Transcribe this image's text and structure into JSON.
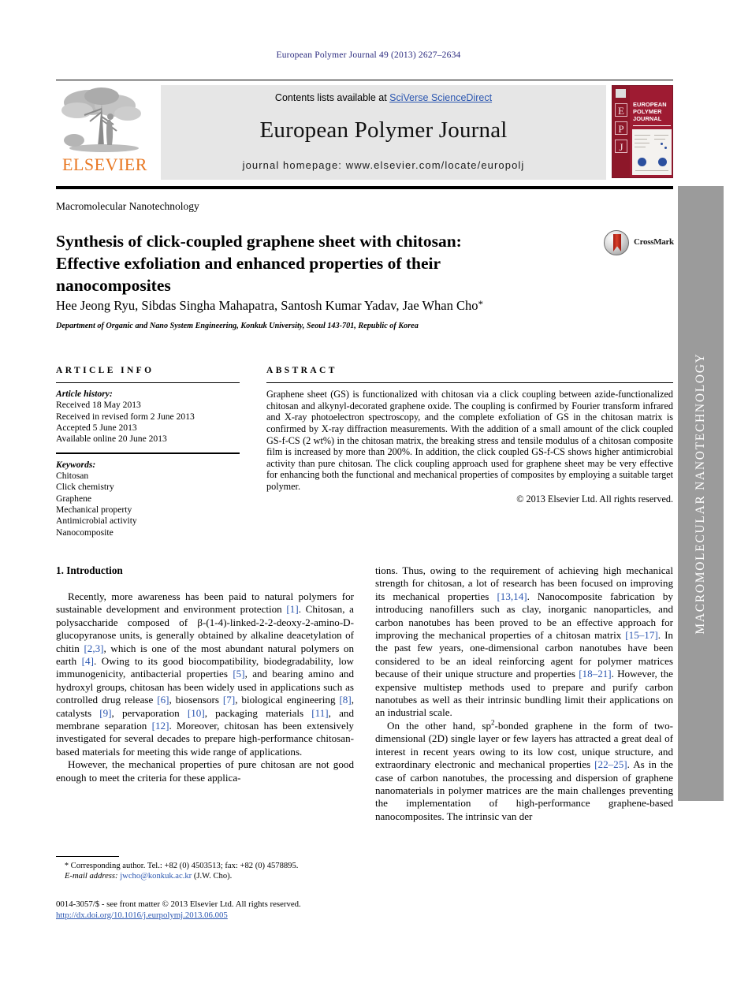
{
  "running_head": "European Polymer Journal 49 (2013) 2627–2634",
  "masthead": {
    "contents_prefix": "Contents lists available at ",
    "contents_link": "SciVerse ScienceDirect",
    "journal_name": "European Polymer Journal",
    "homepage": "journal homepage: www.elsevier.com/locate/europolj",
    "publisher": "ELSEVIER",
    "cover": {
      "title_line1": "EUROPEAN",
      "title_line2": "POLYMER",
      "title_line3": "JOURNAL",
      "letters": [
        "E",
        "P",
        "J"
      ]
    }
  },
  "section_tag": "Macromolecular Nanotechnology",
  "title": "Synthesis of click-coupled graphene sheet with chitosan: Effective exfoliation and enhanced properties of their nanocomposites",
  "crossmark_label": "CrossMark",
  "authors": "Hee Jeong Ryu, Sibdas Singha Mahapatra, Santosh Kumar Yadav, Jae Whan Cho",
  "author_star": "*",
  "affiliation": "Department of Organic and Nano System Engineering, Konkuk University, Seoul 143-701, Republic of Korea",
  "article_info": {
    "heading": "ARTICLE INFO",
    "history_label": "Article history:",
    "history": [
      "Received 18 May 2013",
      "Received in revised form 2 June 2013",
      "Accepted 5 June 2013",
      "Available online 20 June 2013"
    ],
    "keywords_label": "Keywords:",
    "keywords": [
      "Chitosan",
      "Click chemistry",
      "Graphene",
      "Mechanical property",
      "Antimicrobial activity",
      "Nanocomposite"
    ]
  },
  "abstract": {
    "heading": "ABSTRACT",
    "text": "Graphene sheet (GS) is functionalized with chitosan via a click coupling between azide-functionalized chitosan and alkynyl-decorated graphene oxide. The coupling is confirmed by Fourier transform infrared and X-ray photoelectron spectroscopy, and the complete exfoliation of GS in the chitosan matrix is confirmed by X-ray diffraction measurements. With the addition of a small amount of the click coupled GS-f-CS (2 wt%) in the chitosan matrix, the breaking stress and tensile modulus of a chitosan composite film is increased by more than 200%. In addition, the click coupled GS-f-CS shows higher antimicrobial activity than pure chitosan. The click coupling approach used for graphene sheet may be very effective for enhancing both the functional and mechanical properties of composites by employing a suitable target polymer.",
    "rights": "© 2013 Elsevier Ltd. All rights reserved."
  },
  "body": {
    "intro_heading": "1. Introduction",
    "left_paras": [
      "Recently, more awareness has been paid to natural polymers for sustainable development and environment protection [1]. Chitosan, a polysaccharide composed of β-(1-4)-linked-2-2-deoxy-2-amino-D-glucopyranose units, is generally obtained by alkaline deacetylation of chitin [2,3], which is one of the most abundant natural polymers on earth [4]. Owing to its good biocompatibility, biodegradability, low immunogenicity, antibacterial properties [5], and bearing amino and hydroxyl groups, chitosan has been widely used in applications such as controlled drug release [6], biosensors [7], biological engineering [8], catalysts [9], pervaporation [10], packaging materials [11], and membrane separation [12]. Moreover, chitosan has been extensively investigated for several decades to prepare high-performance chitosan-based materials for meeting this wide range of applications.",
      "However, the mechanical properties of pure chitosan are not good enough to meet the criteria for these applica-"
    ],
    "right_paras": [
      "tions. Thus, owing to the requirement of achieving high mechanical strength for chitosan, a lot of research has been focused on improving its mechanical properties [13,14]. Nanocomposite fabrication by introducing nanofillers such as clay, inorganic nanoparticles, and carbon nanotubes has been proved to be an effective approach for improving the mechanical properties of a chitosan matrix [15–17]. In the past few years, one-dimensional carbon nanotubes have been considered to be an ideal reinforcing agent for polymer matrices because of their unique structure and properties [18–21]. However, the expensive multistep methods used to prepare and purify carbon nanotubes as well as their intrinsic bundling limit their applications on an industrial scale.",
      "On the other hand, sp2-bonded graphene in the form of two-dimensional (2D) single layer or few layers has attracted a great deal of interest in recent years owing to its low cost, unique structure, and extraordinary electronic and mechanical properties [22–25]. As in the case of carbon nanotubes, the processing and dispersion of graphene nanomaterials in polymer matrices are the main challenges preventing the implementation of high-performance graphene-based nanocomposites. The intrinsic van der"
    ]
  },
  "footnote": {
    "star": "*",
    "corresponding": " Corresponding author. Tel.: +82 (0) 4503513; fax: +82 (0) 4578895.",
    "email_label": "E-mail address:",
    "email": "jwcho@konkuk.ac.kr",
    "email_suffix": " (J.W. Cho)."
  },
  "imprint": {
    "line1": "0014-3057/$ - see front matter © 2013 Elsevier Ltd. All rights reserved.",
    "doi": "http://dx.doi.org/10.1016/j.eurpolymj.2013.06.005"
  },
  "side_band_text": "MACROMOLECULAR NANOTECHNOLOGY",
  "colors": {
    "link_blue": "#2b56b0",
    "running_head_blue": "#2b2b7f",
    "elsevier_orange": "#e87722",
    "cover_red": "#9e1b32",
    "side_band_gray": "#9b9b9b"
  }
}
